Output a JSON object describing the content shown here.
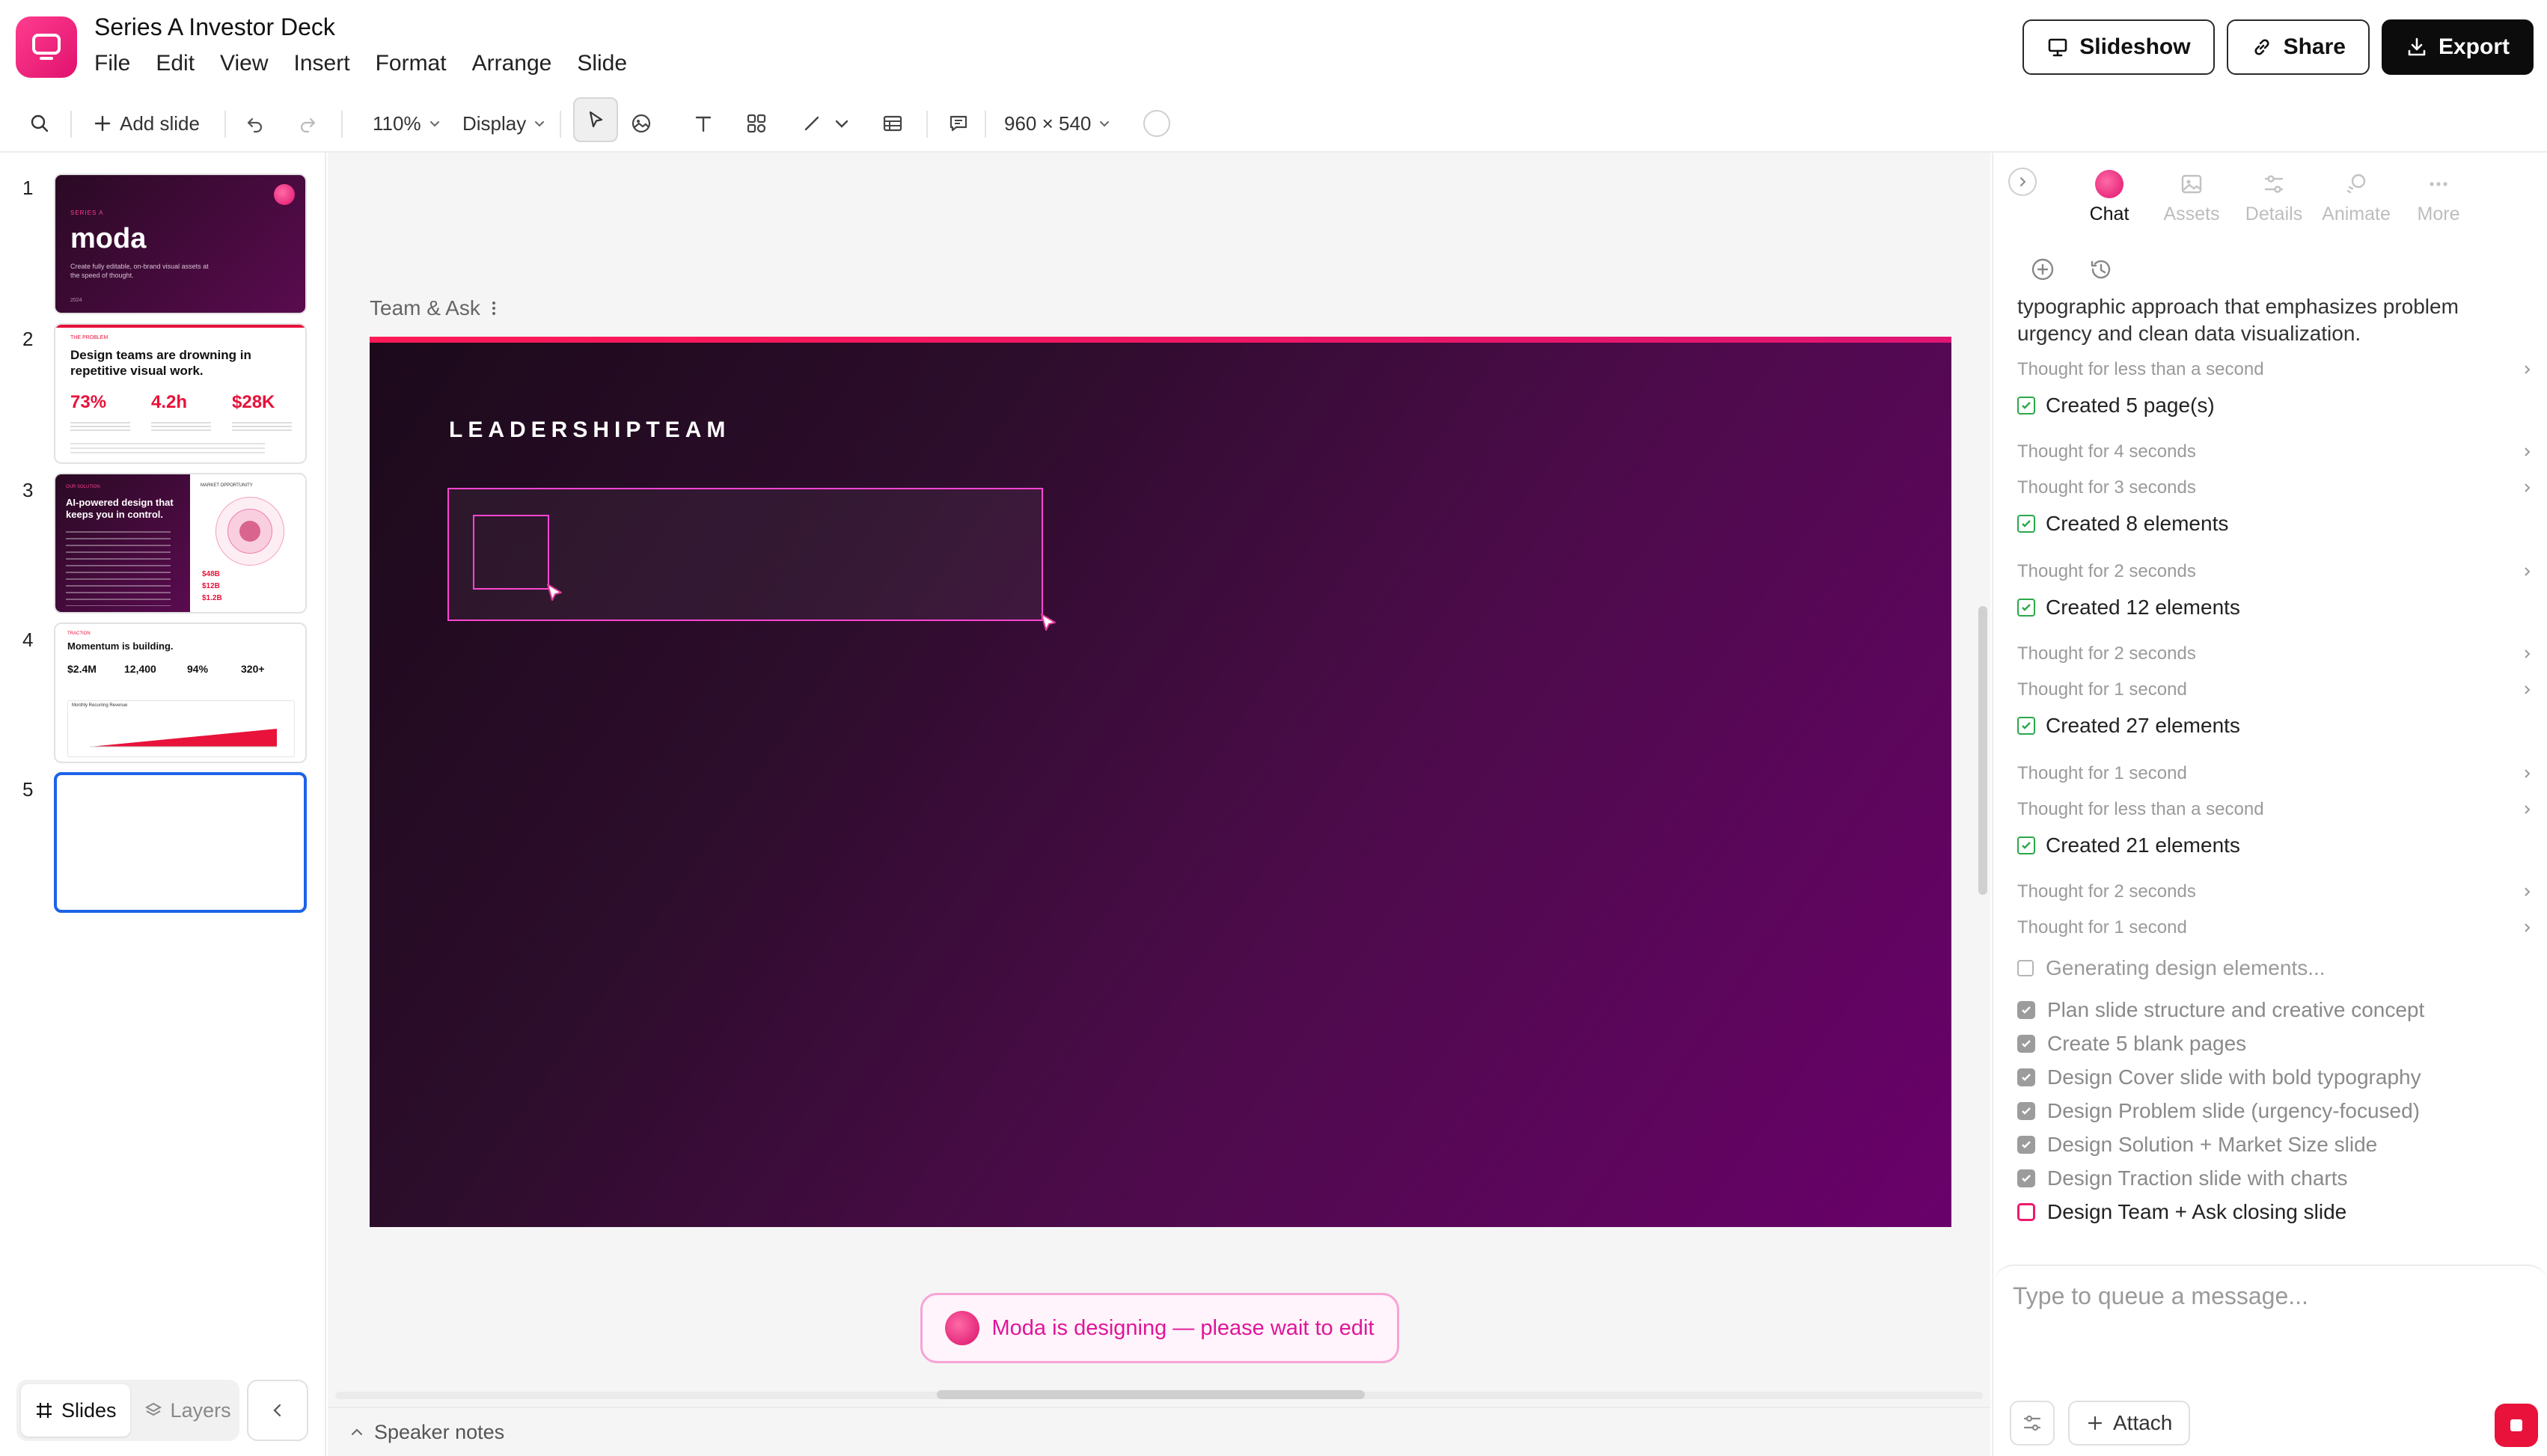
{
  "app": {
    "title": "Series A Investor Deck",
    "brand_color": "#e0126e",
    "accent": "#1d63e8"
  },
  "menu": [
    "File",
    "Edit",
    "View",
    "Insert",
    "Format",
    "Arrange",
    "Slide"
  ],
  "actions": {
    "slideshow": "Slideshow",
    "share": "Share",
    "export": "Export"
  },
  "toolbar": {
    "add_slide": "Add slide",
    "zoom": "110%",
    "display": "Display",
    "canvas_size": "960 × 540"
  },
  "slides_panel": {
    "tabs": {
      "slides": "Slides",
      "layers": "Layers"
    },
    "thumbnails": [
      {
        "number": "1",
        "eyebrow": "SERIES A",
        "title": "moda",
        "body": "Create fully editable, on-brand visual assets at the speed of thought.",
        "footer": "2024"
      },
      {
        "number": "2",
        "eyebrow": "THE PROBLEM",
        "title": "Design teams are drowning in repetitive visual work.",
        "stats": [
          "73%",
          "4.2h",
          "$28K"
        ]
      },
      {
        "number": "3",
        "eyebrow": "OUR SOLUTION",
        "title": "AI-powered design that keeps you in control.",
        "side_label": "MARKET OPPORTUNITY",
        "stats": [
          "$48B",
          "$12B",
          "$1.2B"
        ]
      },
      {
        "number": "4",
        "eyebrow": "TRACTION",
        "title": "Momentum is building.",
        "stats": [
          "$2.4M",
          "12,400",
          "94%",
          "320+"
        ],
        "chart_label": "Monthly Recurring Revenue"
      },
      {
        "number": "5"
      }
    ]
  },
  "canvas": {
    "slide_name": "Team & Ask",
    "heading": "LEADERSHIPTEAM",
    "status": "Moda is designing — please wait to edit",
    "speaker_notes": "Speaker notes"
  },
  "right_panel": {
    "tabs": [
      {
        "label": "Chat",
        "icon": "chameleon-icon",
        "active": true
      },
      {
        "label": "Assets",
        "icon": "image-icon",
        "active": false
      },
      {
        "label": "Details",
        "icon": "sliders-icon",
        "active": false
      },
      {
        "label": "Animate",
        "icon": "animate-icon",
        "active": false
      },
      {
        "label": "More",
        "icon": "more-icon",
        "active": false
      }
    ],
    "feed_intro": "typographic approach that emphasizes problem urgency and clean data visualization.",
    "feed": [
      {
        "type": "thought",
        "text": "Thought for less than a second"
      },
      {
        "type": "created",
        "text": "Created 5 page(s)"
      },
      {
        "type": "thought",
        "text": "Thought for 4 seconds"
      },
      {
        "type": "thought",
        "text": "Thought for 3 seconds"
      },
      {
        "type": "created",
        "text": "Created 8 elements"
      },
      {
        "type": "thought",
        "text": "Thought for 2 seconds"
      },
      {
        "type": "created",
        "text": "Created 12 elements"
      },
      {
        "type": "thought",
        "text": "Thought for 2 seconds"
      },
      {
        "type": "thought",
        "text": "Thought for 1 second"
      },
      {
        "type": "created",
        "text": "Created 27 elements"
      },
      {
        "type": "thought",
        "text": "Thought for 1 second"
      },
      {
        "type": "thought",
        "text": "Thought for less than a second"
      },
      {
        "type": "created",
        "text": "Created 21 elements"
      },
      {
        "type": "thought",
        "text": "Thought for 2 seconds"
      },
      {
        "type": "thought",
        "text": "Thought for 1 second"
      }
    ],
    "generating": "Generating design elements...",
    "tasks": [
      {
        "text": "Plan slide structure and creative concept",
        "done": true
      },
      {
        "text": "Create 5 blank pages",
        "done": true
      },
      {
        "text": "Design Cover slide with bold typography",
        "done": true
      },
      {
        "text": "Design Problem slide (urgency-focused)",
        "done": true
      },
      {
        "text": "Design Solution + Market Size slide",
        "done": true
      },
      {
        "text": "Design Traction slide with charts",
        "done": true
      },
      {
        "text": "Design Team + Ask closing slide",
        "done": false
      }
    ],
    "composer": {
      "placeholder": "Type to queue a message...",
      "attach": "Attach"
    }
  }
}
